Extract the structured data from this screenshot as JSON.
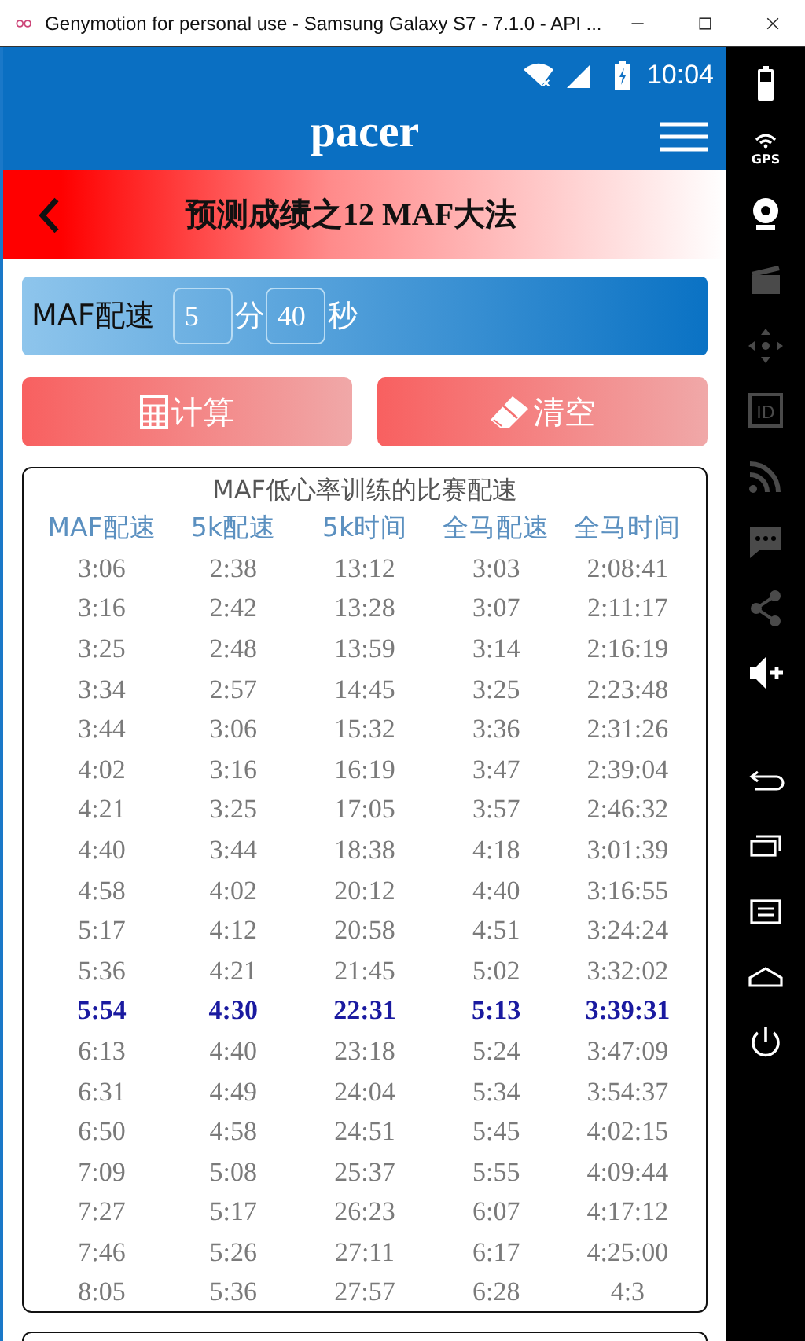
{
  "window": {
    "title": "Genymotion for personal use - Samsung Galaxy S7 - 7.1.0 - API ..."
  },
  "status_bar": {
    "time": "10:04"
  },
  "app_bar": {
    "logo": "pacer"
  },
  "banner": {
    "title": "预测成绩之12 MAF大法"
  },
  "pace_input": {
    "label": "MAF配速",
    "minutes": "5",
    "minutes_unit": "分",
    "seconds": "40",
    "seconds_unit": "秒"
  },
  "buttons": [
    {
      "kind": "calculator",
      "label": "计算"
    },
    {
      "kind": "eraser",
      "label": "清空"
    }
  ],
  "table": {
    "title": "MAF低心率训练的比赛配速",
    "columns": [
      "MAF配速",
      "5k配速",
      "5k时间",
      "全马配速",
      "全马时间"
    ],
    "rows": [
      {
        "selected": false,
        "cells": [
          "3:06",
          "2:38",
          "13:12",
          "3:03",
          "2:08:41"
        ]
      },
      {
        "selected": false,
        "cells": [
          "3:16",
          "2:42",
          "13:28",
          "3:07",
          "2:11:17"
        ]
      },
      {
        "selected": false,
        "cells": [
          "3:25",
          "2:48",
          "13:59",
          "3:14",
          "2:16:19"
        ]
      },
      {
        "selected": false,
        "cells": [
          "3:34",
          "2:57",
          "14:45",
          "3:25",
          "2:23:48"
        ]
      },
      {
        "selected": false,
        "cells": [
          "3:44",
          "3:06",
          "15:32",
          "3:36",
          "2:31:26"
        ]
      },
      {
        "selected": false,
        "cells": [
          "4:02",
          "3:16",
          "16:19",
          "3:47",
          "2:39:04"
        ]
      },
      {
        "selected": false,
        "cells": [
          "4:21",
          "3:25",
          "17:05",
          "3:57",
          "2:46:32"
        ]
      },
      {
        "selected": false,
        "cells": [
          "4:40",
          "3:44",
          "18:38",
          "4:18",
          "3:01:39"
        ]
      },
      {
        "selected": false,
        "cells": [
          "4:58",
          "4:02",
          "20:12",
          "4:40",
          "3:16:55"
        ]
      },
      {
        "selected": false,
        "cells": [
          "5:17",
          "4:12",
          "20:58",
          "4:51",
          "3:24:24"
        ]
      },
      {
        "selected": false,
        "cells": [
          "5:36",
          "4:21",
          "21:45",
          "5:02",
          "3:32:02"
        ]
      },
      {
        "selected": true,
        "cells": [
          "5:54",
          "4:30",
          "22:31",
          "5:13",
          "3:39:31"
        ]
      },
      {
        "selected": false,
        "cells": [
          "6:13",
          "4:40",
          "23:18",
          "5:24",
          "3:47:09"
        ]
      },
      {
        "selected": false,
        "cells": [
          "6:31",
          "4:49",
          "24:04",
          "5:34",
          "3:54:37"
        ]
      },
      {
        "selected": false,
        "cells": [
          "6:50",
          "4:58",
          "24:51",
          "5:45",
          "4:02:15"
        ]
      },
      {
        "selected": false,
        "cells": [
          "7:09",
          "5:08",
          "25:37",
          "5:55",
          "4:09:44"
        ]
      },
      {
        "selected": false,
        "cells": [
          "7:27",
          "5:17",
          "26:23",
          "6:07",
          "4:17:12"
        ]
      },
      {
        "selected": false,
        "cells": [
          "7:46",
          "5:26",
          "27:11",
          "6:17",
          "4:25:00"
        ]
      },
      {
        "selected": false,
        "cells": [
          "8:05",
          "5:36",
          "27:57",
          "6:28",
          "4:3"
        ]
      }
    ]
  },
  "emulator_toolbar": {
    "items": [
      {
        "kind": "battery",
        "disabled": false
      },
      {
        "kind": "gps",
        "label": "GPS",
        "disabled": false
      },
      {
        "kind": "webcam",
        "disabled": false
      },
      {
        "kind": "clapper",
        "disabled": true
      },
      {
        "kind": "dpad",
        "disabled": true
      },
      {
        "kind": "id",
        "label": "ID",
        "disabled": true
      },
      {
        "kind": "rss",
        "disabled": true
      },
      {
        "kind": "message",
        "disabled": true
      },
      {
        "kind": "share",
        "disabled": true
      },
      {
        "kind": "volume",
        "disabled": false
      },
      {
        "kind": "gap"
      },
      {
        "kind": "back",
        "disabled": false
      },
      {
        "kind": "recents",
        "disabled": false
      },
      {
        "kind": "menu",
        "disabled": false
      },
      {
        "kind": "home",
        "disabled": false
      },
      {
        "kind": "power",
        "disabled": false
      }
    ]
  }
}
